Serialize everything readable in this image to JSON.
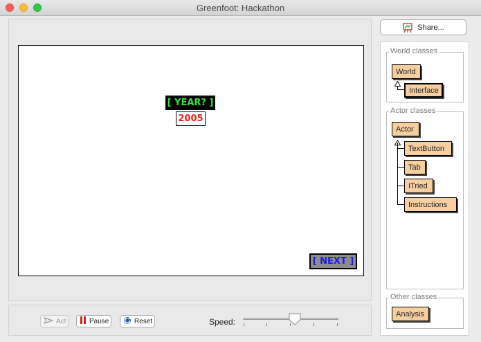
{
  "window": {
    "title": "Greenfoot: Hackathon"
  },
  "world": {
    "year_label": "[ YEAR? ]",
    "year_value": "2005",
    "next_label": "[ NEXT ]"
  },
  "controls": {
    "act_label": "Act",
    "pause_label": "Pause",
    "reset_label": "Reset",
    "speed_label": "Speed:",
    "speed_level": 0.55
  },
  "share": {
    "label": "Share..."
  },
  "classes": {
    "world_title": "World classes",
    "world_items": [
      "World",
      "Interface"
    ],
    "actor_title": "Actor classes",
    "actor_items": [
      "Actor",
      "TextButton",
      "Tab",
      "ITried",
      "Instructions"
    ],
    "other_title": "Other classes",
    "other_items": [
      "Analysis"
    ]
  },
  "colors": {
    "class_fill": "#f6cfa0",
    "year_label_text": "#37e23c",
    "year_value_text": "#e8231b",
    "next_text": "#1d1de0",
    "next_fill": "#8c8c8c"
  }
}
